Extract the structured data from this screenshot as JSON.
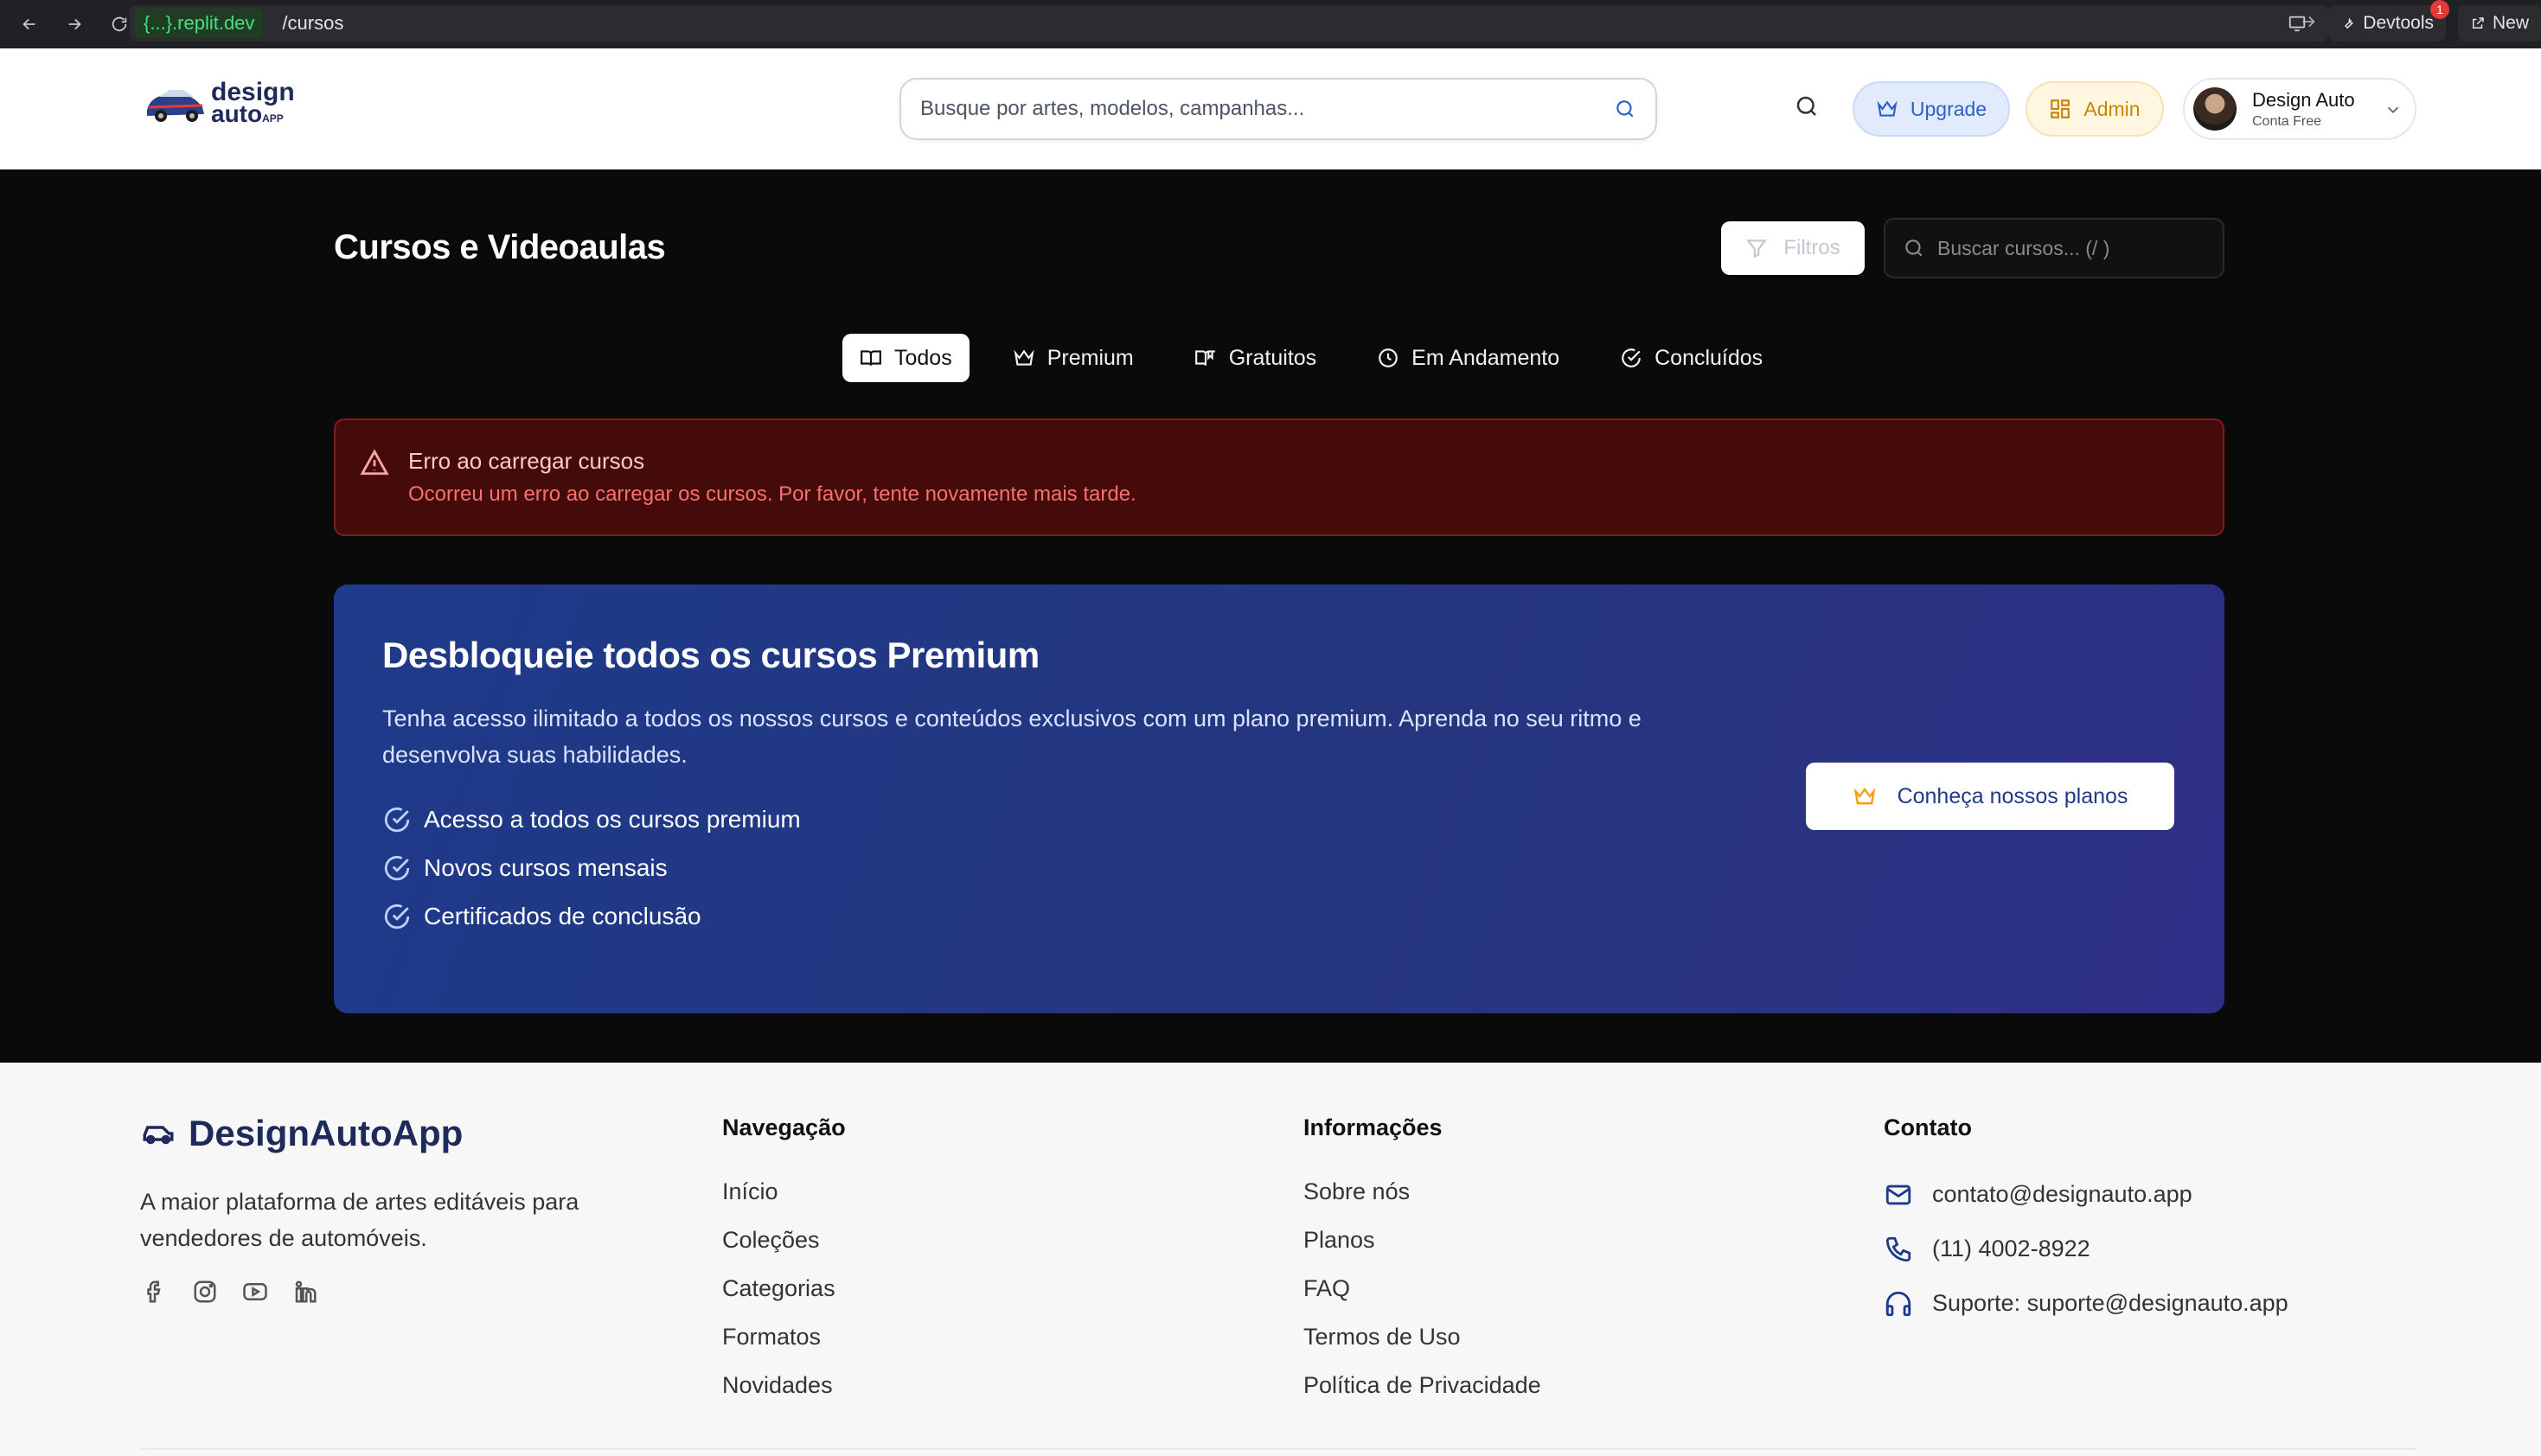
{
  "browser": {
    "host": "{...}.replit.dev",
    "path": "/cursos",
    "devtools_label": "Devtools",
    "devtools_badge": "1",
    "new_label": "New"
  },
  "header": {
    "logo_line1": "design",
    "logo_line2": "auto",
    "logo_line2_small": "APP",
    "search_placeholder": "Busque por artes, modelos, campanhas...",
    "upgrade_label": "Upgrade",
    "admin_label": "Admin",
    "user_name": "Design Auto",
    "user_plan": "Conta Free"
  },
  "main": {
    "title": "Cursos e Videoaulas",
    "filter_label": "Filtros",
    "search_placeholder": "Buscar cursos... (/ )",
    "tabs": [
      {
        "label": "Todos",
        "icon": "book-open-icon",
        "active": true
      },
      {
        "label": "Premium",
        "icon": "crown-icon",
        "active": false
      },
      {
        "label": "Gratuitos",
        "icon": "book-icon",
        "active": false
      },
      {
        "label": "Em Andamento",
        "icon": "clock-icon",
        "active": false
      },
      {
        "label": "Concluídos",
        "icon": "check-circle-icon",
        "active": false
      }
    ],
    "error": {
      "title": "Erro ao carregar cursos",
      "message": "Ocorreu um erro ao carregar os cursos. Por favor, tente novamente mais tarde."
    },
    "promo": {
      "title": "Desbloqueie todos os cursos Premium",
      "description": "Tenha acesso ilimitado a todos os nossos cursos e conteúdos exclusivos com um plano premium. Aprenda no seu ritmo e desenvolva suas habilidades.",
      "benefits": [
        "Acesso a todos os cursos premium",
        "Novos cursos mensais",
        "Certificados de conclusão"
      ],
      "cta_label": "Conheça nossos planos"
    }
  },
  "footer": {
    "brand": "DesignAutoApp",
    "tagline": "A maior plataforma de artes editáveis para vendedores de automóveis.",
    "navigation": {
      "title": "Navegação",
      "links": [
        "Início",
        "Coleções",
        "Categorias",
        "Formatos",
        "Novidades"
      ]
    },
    "info": {
      "title": "Informações",
      "links": [
        "Sobre nós",
        "Planos",
        "FAQ",
        "Termos de Uso",
        "Política de Privacidade"
      ]
    },
    "contact": {
      "title": "Contato",
      "email": "contato@designauto.app",
      "phone": "(11) 4002-8922",
      "support": "Suporte: suporte@designauto.app"
    }
  },
  "colors": {
    "accent_blue": "#2d5fc9",
    "admin_gold": "#c9820c",
    "error_bg": "#450a0a",
    "promo_bg": "#1e3a8a"
  }
}
